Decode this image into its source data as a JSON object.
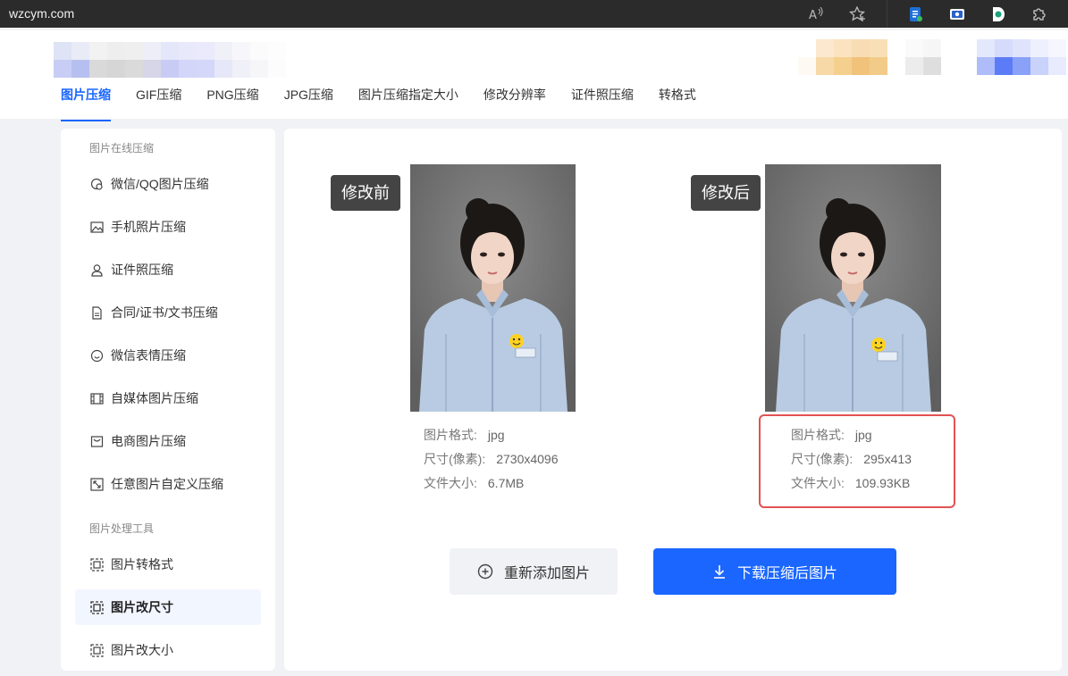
{
  "browser": {
    "url": "wzcym.com"
  },
  "nav": {
    "tabs": [
      "图片压缩",
      "GIF压缩",
      "PNG压缩",
      "JPG压缩",
      "图片压缩指定大小",
      "修改分辨率",
      "证件照压缩",
      "转格式"
    ],
    "active_index": 0
  },
  "sidebar": {
    "section1_title": "图片在线压缩",
    "section1_items": [
      "微信/QQ图片压缩",
      "手机照片压缩",
      "证件照压缩",
      "合同/证书/文书压缩",
      "微信表情压缩",
      "自媒体图片压缩",
      "电商图片压缩",
      "任意图片自定义压缩"
    ],
    "section2_title": "图片处理工具",
    "section2_items": [
      "图片转格式",
      "图片改尺寸",
      "图片改大小"
    ],
    "active_item": "图片改尺寸"
  },
  "main": {
    "before": {
      "tag": "修改前",
      "format_label": "图片格式:",
      "format_value": "jpg",
      "size_label": "尺寸(像素):",
      "size_value": "2730x4096",
      "file_label": "文件大小:",
      "file_value": "6.7MB"
    },
    "after": {
      "tag": "修改后",
      "format_label": "图片格式:",
      "format_value": "jpg",
      "size_label": "尺寸(像素):",
      "size_value": "295x413",
      "file_label": "文件大小:",
      "file_value": "109.93KB"
    },
    "re_add_button": "重新添加图片",
    "download_button": "下载压缩后图片"
  },
  "colors": {
    "accent": "#1a66ff",
    "highlight_border": "#e25252",
    "browser_bar": "#2b2b2b"
  }
}
